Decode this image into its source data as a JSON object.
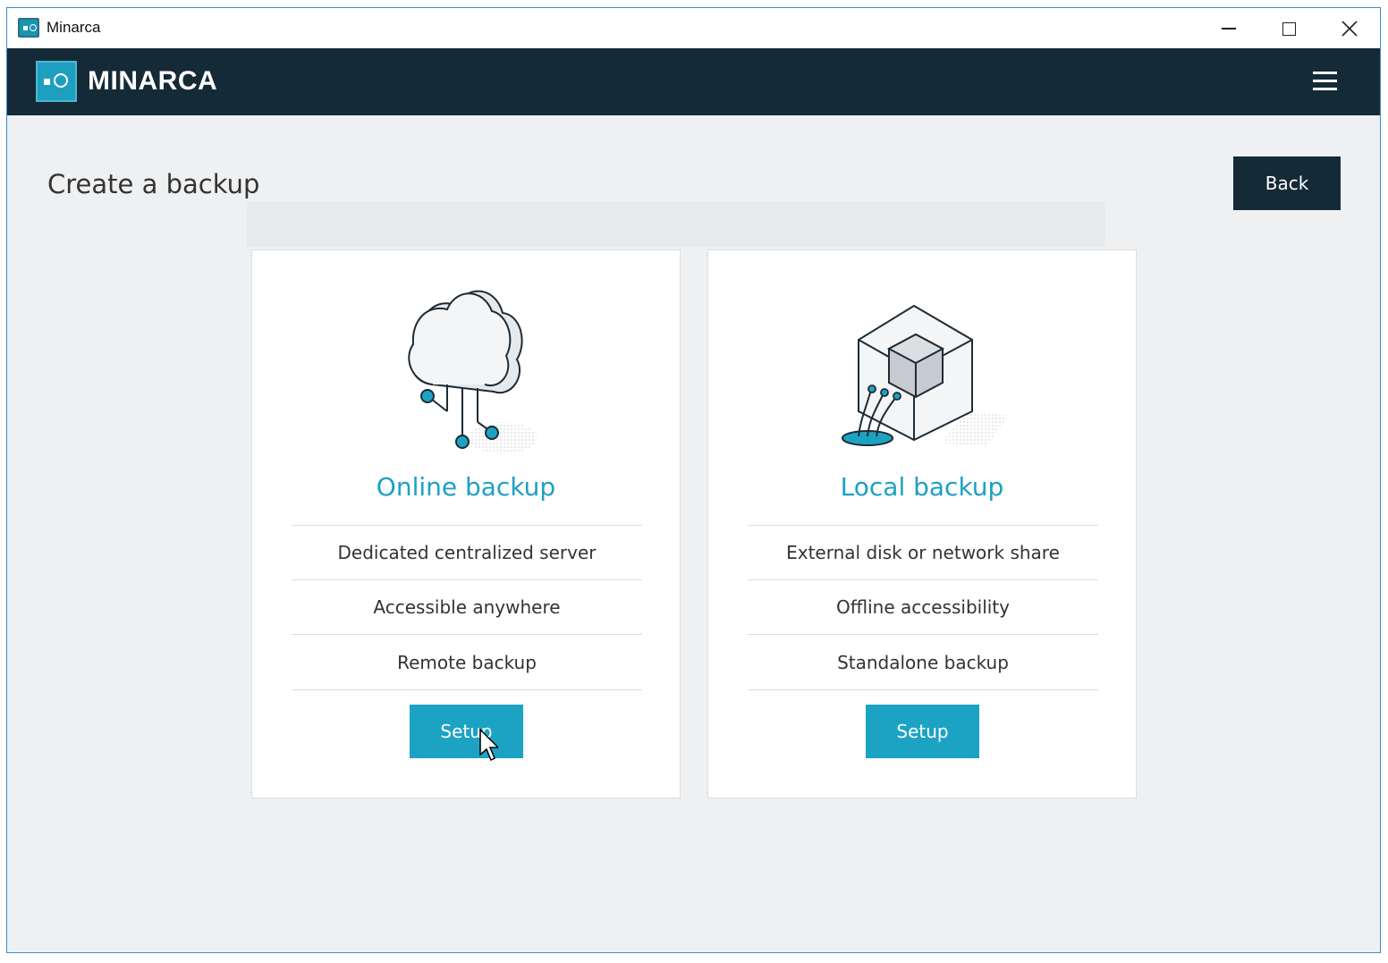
{
  "window": {
    "title": "Minarca"
  },
  "header": {
    "brand": "MINARCA"
  },
  "page": {
    "title": "Create a backup",
    "back_label": "Back"
  },
  "options": [
    {
      "title": "Online backup",
      "features": [
        "Dedicated centralized server",
        "Accessible anywhere",
        "Remote backup"
      ],
      "button_label": "Setup"
    },
    {
      "title": "Local backup",
      "features": [
        "External disk or network share",
        "Offline accessibility",
        "Standalone backup"
      ],
      "button_label": "Setup"
    }
  ],
  "colors": {
    "header_bg": "#142a37",
    "accent": "#1ca3c4",
    "page_bg": "#eef0f2"
  }
}
